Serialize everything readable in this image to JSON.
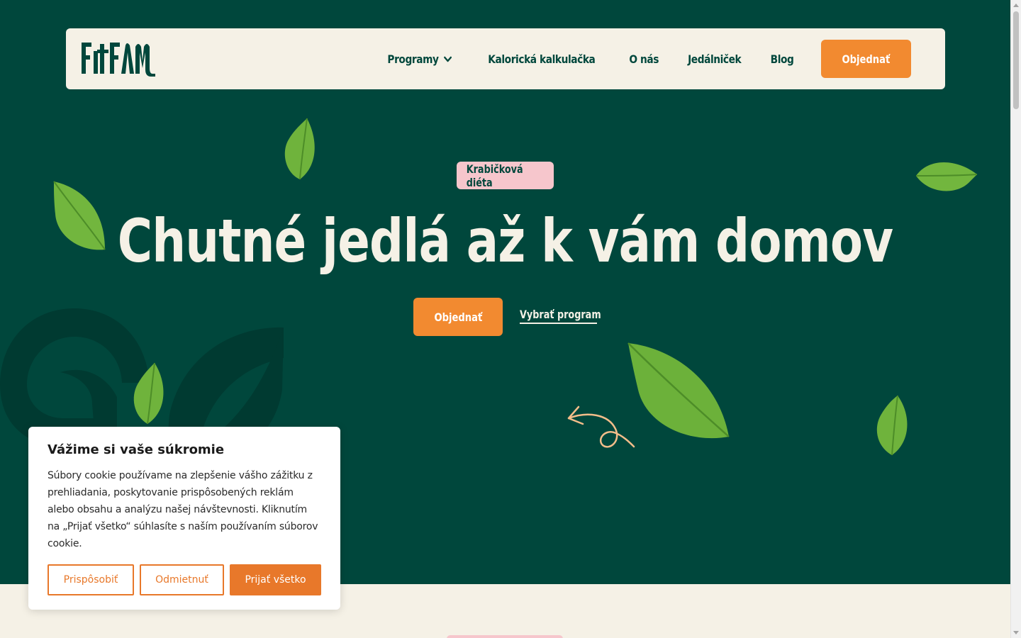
{
  "nav": {
    "logo_text": "FITFAM",
    "links": [
      {
        "label": "Programy",
        "has_dropdown": true
      },
      {
        "label": "Kalorická kalkulačka"
      },
      {
        "label": "O nás"
      },
      {
        "label": "Jedálniček"
      },
      {
        "label": "Blog"
      }
    ],
    "cta_label": "Objednať"
  },
  "hero": {
    "badge": "Krabičková diéta",
    "headline": "Chutné jedlá až k vám domov",
    "cta_primary": "Objednať",
    "cta_secondary": "Vybrať program"
  },
  "cookie": {
    "title": "Vážime si vaše súkromie",
    "text": "Súbory cookie používame na zlepšenie vášho zážitku z prehliadania, poskytovanie prispôsobených reklám alebo obsahu a analýzu našej návštevnosti. Kliknutím na „Prijať všetko“ súhlasíte s naším používaním súborov cookie.",
    "btn_customize": "Prispôsobiť",
    "btn_reject": "Odmietnuť",
    "btn_accept": "Prijať všetko"
  },
  "colors": {
    "brand_green": "#00473c",
    "cream": "#f5f1e6",
    "accent_orange": "#f28a30",
    "badge_pink": "#f6c6cc",
    "leaf_green": "#6fb33c"
  }
}
